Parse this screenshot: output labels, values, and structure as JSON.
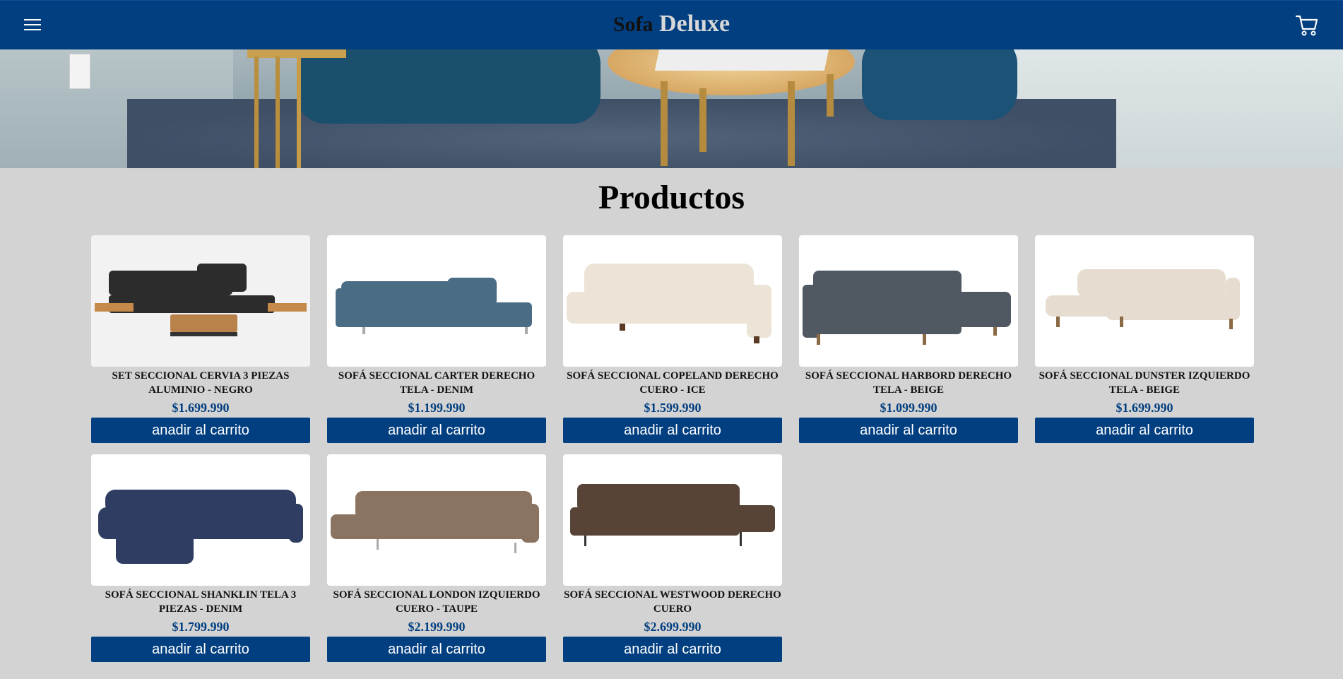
{
  "header": {
    "brand_part1": "Sofa",
    "brand_part2": "Deluxe",
    "menu_icon": "hamburger-menu-icon",
    "cart_icon": "shopping-cart-icon",
    "bg_color": "#023f80"
  },
  "main": {
    "title": "Productos"
  },
  "products": [
    {
      "name": "SET SECCIONAL CERVIA 3 PIEZAS ALUMINIO - NEGRO",
      "price": "$1.699.990",
      "button": "anadir al carrito",
      "color": "#2c2c2c"
    },
    {
      "name": "SOFÁ SECCIONAL CARTER DERECHO TELA - DENIM",
      "price": "$1.199.990",
      "button": "anadir al carrito",
      "color": "#4a6c84"
    },
    {
      "name": "SOFÁ SECCIONAL COPELAND DERECHO CUERO - ICE",
      "price": "$1.599.990",
      "button": "anadir al carrito",
      "color": "#ece4d6"
    },
    {
      "name": "SOFÁ SECCIONAL HARBORD DERECHO TELA - BEIGE",
      "price": "$1.099.990",
      "button": "anadir al carrito",
      "color": "#505961"
    },
    {
      "name": "SOFÁ SECCIONAL DUNSTER IZQUIERDO TELA - BEIGE",
      "price": "$1.699.990",
      "button": "anadir al carrito",
      "color": "#e6ddd0"
    },
    {
      "name": "SOFÁ SECCIONAL SHANKLIN TELA 3 PIEZAS - DENIM",
      "price": "$1.799.990",
      "button": "anadir al carrito",
      "color": "#2f3d63"
    },
    {
      "name": "SOFÁ SECCIONAL LONDON IZQUIERDO CUERO - TAUPE",
      "price": "$2.199.990",
      "button": "anadir al carrito",
      "color": "#8a7360"
    },
    {
      "name": "SOFÁ SECCIONAL WESTWOOD DERECHO CUERO",
      "price": "$2.699.990",
      "button": "anadir al carrito",
      "color": "#574436"
    }
  ]
}
